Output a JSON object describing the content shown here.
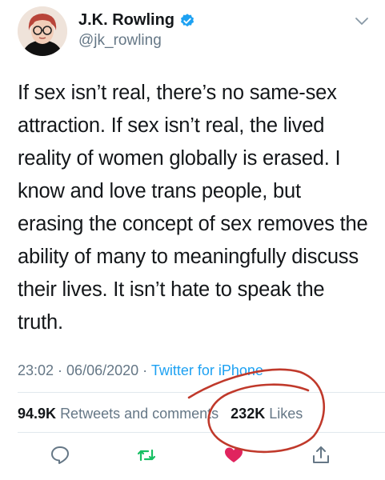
{
  "author": {
    "name": "J.K. Rowling",
    "handle": "@jk_rowling",
    "verified": true
  },
  "tweet": {
    "text": "If sex isn’t real, there’s no same-sex attraction. If sex isn’t real, the lived reality of women globally is erased. I know and love trans people, but erasing the concept of sex removes the ability of many to meaningfully discuss their lives. It isn’t hate to speak the truth."
  },
  "meta": {
    "time": "23:02",
    "separator1": " · ",
    "date": "06/06/2020",
    "separator2": " · ",
    "source": "Twitter for iPhone"
  },
  "stats": {
    "retweets_count": "94.9K",
    "retweets_label": "Retweets and comments",
    "likes_count": "232K",
    "likes_label": "Likes"
  },
  "actions": [
    {
      "icon": "comment-icon"
    },
    {
      "icon": "retweet-icon"
    },
    {
      "icon": "like-icon"
    },
    {
      "icon": "share-icon"
    }
  ],
  "colors": {
    "text": "#14171a",
    "secondary": "#657786",
    "link": "#1da1f2",
    "retweet": "#17bf63",
    "like": "#e0245e",
    "annotation": "#c0392b"
  }
}
